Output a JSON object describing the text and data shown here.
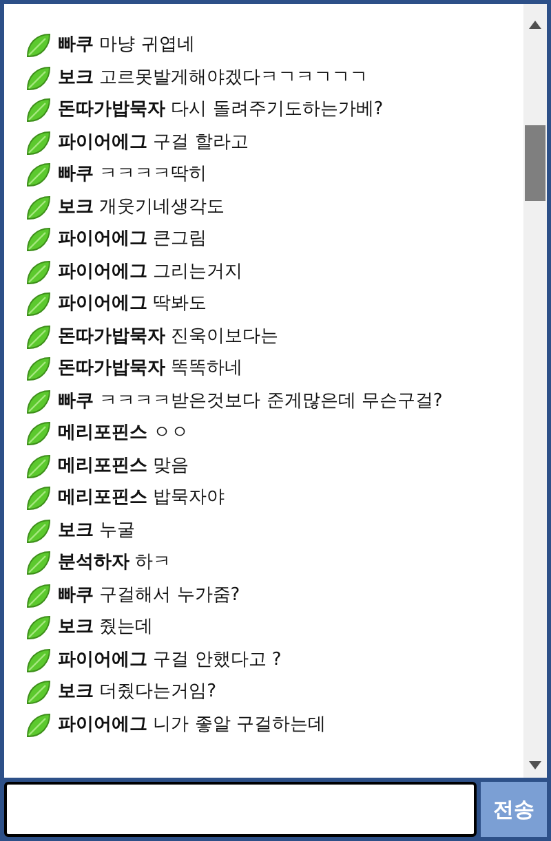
{
  "messages": [
    {
      "name": "빠쿠",
      "text": "마냥 귀엽네"
    },
    {
      "name": "보크",
      "text": "고르못발게해야겠다ㅋㄱㅋㄱㄱㄱ"
    },
    {
      "name": "돈따가밥묵자",
      "text": "다시 돌려주기도하는가베?"
    },
    {
      "name": "파이어에그",
      "text": "구걸 할라고"
    },
    {
      "name": "빠쿠",
      "text": "ㅋㅋㅋㅋ딱히"
    },
    {
      "name": "보크",
      "text": "개웃기네생각도"
    },
    {
      "name": "파이어에그",
      "text": "큰그림"
    },
    {
      "name": "파이어에그",
      "text": "그리는거지"
    },
    {
      "name": "파이어에그",
      "text": "딱봐도"
    },
    {
      "name": "돈따가밥묵자",
      "text": "진욱이보다는"
    },
    {
      "name": "돈따가밥묵자",
      "text": "똑똑하네"
    },
    {
      "name": "빠쿠",
      "text": "ㅋㅋㅋㅋ받은것보다 준게많은데 무슨구걸?"
    },
    {
      "name": "메리포핀스",
      "text": "ㅇㅇ"
    },
    {
      "name": "메리포핀스",
      "text": "맞음"
    },
    {
      "name": "메리포핀스",
      "text": "밥묵자야"
    },
    {
      "name": "보크",
      "text": "누굴"
    },
    {
      "name": "분석하자",
      "text": "하ㅋ"
    },
    {
      "name": "빠쿠",
      "text": "구걸해서 누가줌?"
    },
    {
      "name": "보크",
      "text": "줬는데"
    },
    {
      "name": "파이어에그",
      "text": "구걸 안했다고 ?"
    },
    {
      "name": "보크",
      "text": "더줬다는거임?"
    },
    {
      "name": "파이어에그",
      "text": "니가 좋알 구걸하는데"
    }
  ],
  "send_button": "전송"
}
